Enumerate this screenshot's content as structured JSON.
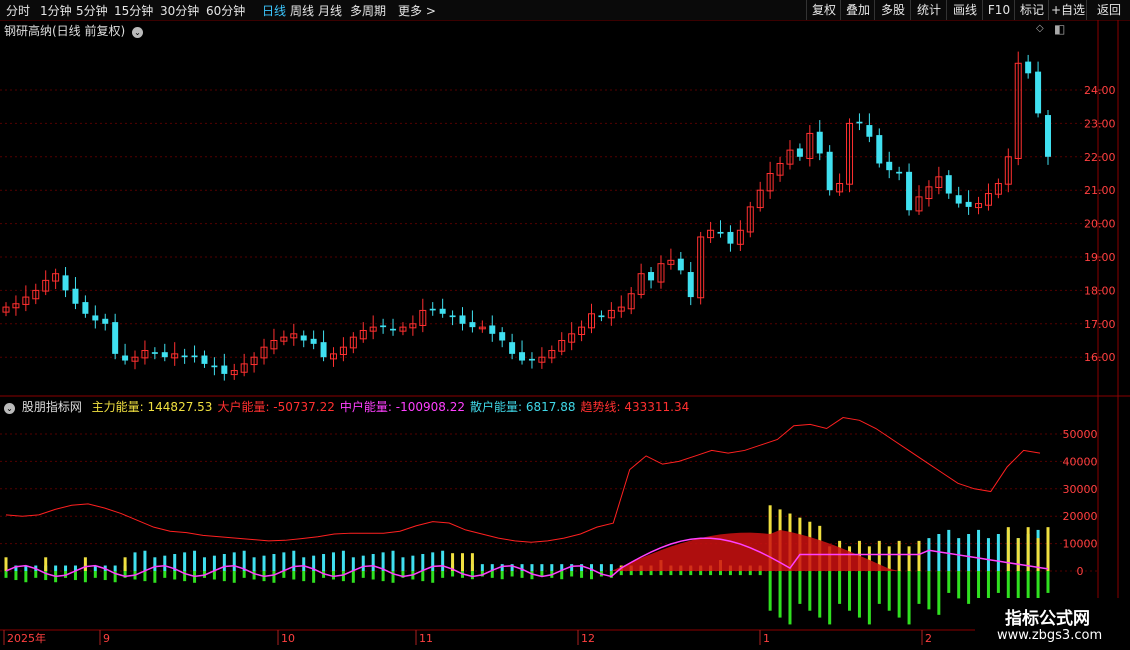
{
  "topbar": {
    "periods": [
      {
        "label": "分时",
        "active": false
      },
      {
        "label": "1分钟",
        "active": false
      },
      {
        "label": "5分钟",
        "active": false
      },
      {
        "label": "15分钟",
        "active": false
      },
      {
        "label": "30分钟",
        "active": false
      },
      {
        "label": "60分钟",
        "active": false
      },
      {
        "label": "日线",
        "active": true
      },
      {
        "label": "周线",
        "active": false
      },
      {
        "label": "月线",
        "active": false
      },
      {
        "label": "多周期",
        "active": false
      },
      {
        "label": "更多",
        "active": false
      }
    ],
    "right_buttons": [
      "复权",
      "叠加",
      "多股",
      "统计",
      "画线",
      "F10",
      "标记",
      "+自选",
      "返回"
    ]
  },
  "price_panel": {
    "title": "钢研高纳(日线 前复权)",
    "ticks": [
      "24.00",
      "23.00",
      "22.00",
      "21.00",
      "20.00",
      "19.00",
      "18.00",
      "17.00",
      "16.00"
    ]
  },
  "indicator_panel": {
    "name": "股朋指标网",
    "items": [
      {
        "label": "主力能量:",
        "value": "144827.53",
        "color": "#f0e040"
      },
      {
        "label": "大户能量:",
        "value": "-50737.22",
        "color": "#ff3030"
      },
      {
        "label": "中户能量:",
        "value": "-100908.22",
        "color": "#ff40ff"
      },
      {
        "label": "散户能量:",
        "value": "6817.88",
        "color": "#40d8e8"
      },
      {
        "label": "趋势线:",
        "value": "433311.34",
        "color": "#ff3030"
      }
    ],
    "ticks": [
      "50000",
      "40000",
      "30000",
      "20000",
      "10000",
      "0"
    ]
  },
  "date_axis": [
    "2025年",
    "9",
    "10",
    "11",
    "12",
    "1",
    "2"
  ],
  "watermark": {
    "title": "指标公式网",
    "url": "www.zbgs3.com"
  },
  "colors": {
    "up": "#ff3030",
    "down": "#40e0f0",
    "grid": "#550000",
    "yellow": "#f0e040",
    "green": "#30e020",
    "magenta": "#ff40ff"
  },
  "chart_data": {
    "type": "candlestick",
    "price_axis_ticks": [
      16,
      17,
      18,
      19,
      20,
      21,
      22,
      23,
      24
    ],
    "indicator_axis_ticks": [
      0,
      10000,
      20000,
      30000,
      40000,
      50000
    ],
    "close_series": [
      17.5,
      17.6,
      17.8,
      18.0,
      18.3,
      18.5,
      18.0,
      17.6,
      17.3,
      17.1,
      17.0,
      16.1,
      15.9,
      16.0,
      16.2,
      16.1,
      16.0,
      16.1,
      16.0,
      16.0,
      15.8,
      15.7,
      15.5,
      15.6,
      15.8,
      16.0,
      16.3,
      16.5,
      16.6,
      16.7,
      16.5,
      16.4,
      16.0,
      16.1,
      16.3,
      16.6,
      16.8,
      16.9,
      16.9,
      16.8,
      16.9,
      17.0,
      17.4,
      17.4,
      17.3,
      17.2,
      17.0,
      16.9,
      16.9,
      16.7,
      16.5,
      16.1,
      15.9,
      15.9,
      16.0,
      16.2,
      16.5,
      16.7,
      16.9,
      17.3,
      17.2,
      17.4,
      17.5,
      17.9,
      18.5,
      18.3,
      18.8,
      18.9,
      18.6,
      17.8,
      19.6,
      19.8,
      19.7,
      19.4,
      19.8,
      20.5,
      21.0,
      21.5,
      21.8,
      22.2,
      22.0,
      22.7,
      22.1,
      21.0,
      21.2,
      23.0,
      23.0,
      22.6,
      21.8,
      21.6,
      21.5,
      20.4,
      20.8,
      21.1,
      21.4,
      20.9,
      20.6,
      20.5,
      20.6,
      20.9,
      21.2,
      22.0,
      24.8,
      24.5,
      23.3,
      22.0
    ],
    "trend_series": [
      20500,
      20000,
      20500,
      22500,
      24000,
      24500,
      23000,
      21000,
      18500,
      16000,
      14500,
      14000,
      13000,
      12500,
      12000,
      11500,
      11000,
      11200,
      11800,
      12500,
      13500,
      13800,
      13800,
      13800,
      14500,
      16500,
      18000,
      17500,
      15000,
      13500,
      12000,
      11000,
      10500,
      11000,
      12000,
      13500,
      16000,
      17500,
      37000,
      42000,
      39000,
      40000,
      42000,
      44000,
      43000,
      44000,
      46000,
      48000,
      53000,
      53500,
      52000,
      56000,
      55000,
      52000,
      48000,
      44000,
      40000,
      36000,
      32000,
      30000,
      29000,
      38000,
      44000,
      43000
    ]
  }
}
